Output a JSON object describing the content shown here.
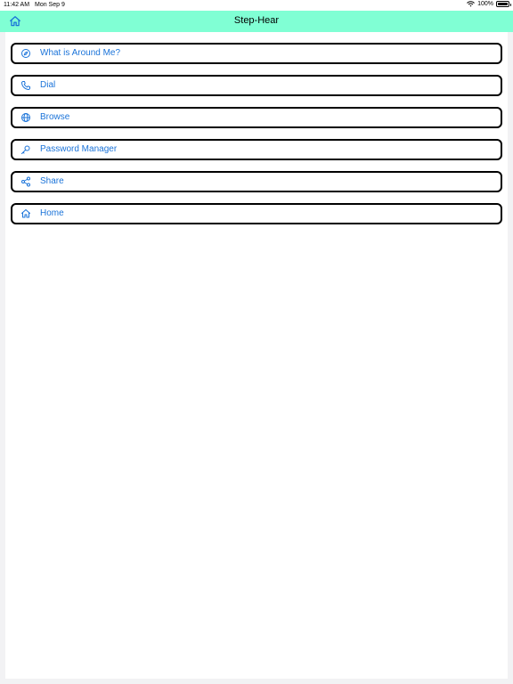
{
  "status_bar": {
    "time": "11:42 AM",
    "date": "Mon Sep 9",
    "battery": "100%",
    "battery_level": 1.0
  },
  "nav_bar": {
    "title": "Step-Hear",
    "background_color": "#80ffd4",
    "left_icon": "home-icon"
  },
  "menu": {
    "accent_color": "#1a73d9",
    "items": [
      {
        "label": "What is Around Me?",
        "icon": "compass-icon"
      },
      {
        "label": "Dial",
        "icon": "phone-icon"
      },
      {
        "label": "Browse",
        "icon": "globe-icon"
      },
      {
        "label": "Password Manager",
        "icon": "key-icon"
      },
      {
        "label": "Share",
        "icon": "share-icon"
      },
      {
        "label": "Home",
        "icon": "home-icon"
      }
    ]
  }
}
